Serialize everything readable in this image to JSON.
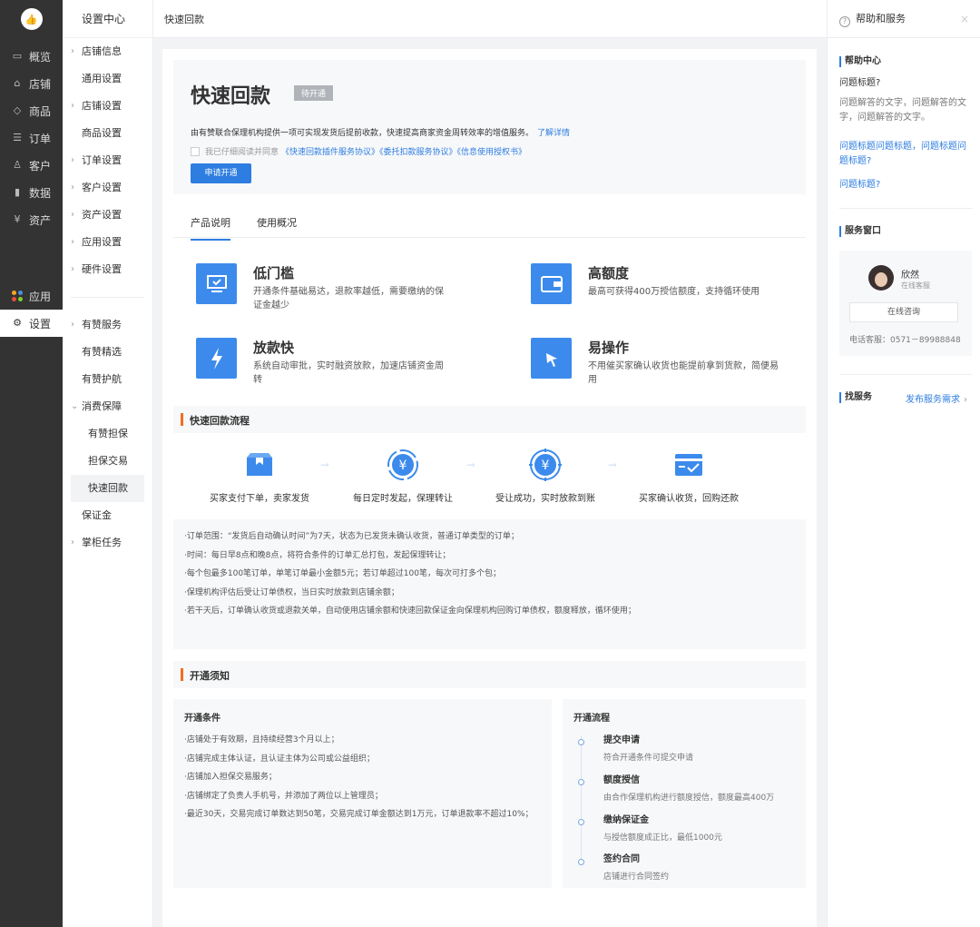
{
  "nav1": {
    "logo_glyph": "👍",
    "items": [
      {
        "label": "概览",
        "icon": "overview-icon",
        "glyph": "▭"
      },
      {
        "label": "店铺",
        "icon": "store-icon",
        "glyph": "⌂"
      },
      {
        "label": "商品",
        "icon": "tag-icon",
        "glyph": "◇"
      },
      {
        "label": "订单",
        "icon": "order-icon",
        "glyph": "☰"
      },
      {
        "label": "客户",
        "icon": "customer-icon",
        "glyph": "♙"
      },
      {
        "label": "数据",
        "icon": "chart-icon",
        "glyph": "▮"
      },
      {
        "label": "资产",
        "icon": "yen-icon",
        "glyph": "¥"
      }
    ],
    "apps_label": "应用",
    "apps_colors": [
      "#f5a623",
      "#4a90e2",
      "#e94b3c",
      "#7ed321"
    ],
    "settings_label": "设置",
    "settings_glyph": "⚙"
  },
  "nav2": {
    "title": "设置中心",
    "group1": [
      {
        "label": "店铺信息",
        "arrow": true
      },
      {
        "label": "通用设置",
        "arrow": false
      },
      {
        "label": "店铺设置",
        "arrow": true
      },
      {
        "label": "商品设置",
        "arrow": false
      },
      {
        "label": "订单设置",
        "arrow": true
      },
      {
        "label": "客户设置",
        "arrow": true
      },
      {
        "label": "资产设置",
        "arrow": true
      },
      {
        "label": "应用设置",
        "arrow": true
      },
      {
        "label": "硬件设置",
        "arrow": true
      }
    ],
    "group2": [
      {
        "label": "有赞服务",
        "arrow": true
      },
      {
        "label": "有赞精选",
        "arrow": false
      },
      {
        "label": "有赞护航",
        "arrow": false
      },
      {
        "label": "消费保障",
        "arrow": true,
        "expanded": true
      },
      {
        "label": "有赞担保",
        "sub": true
      },
      {
        "label": "担保交易",
        "sub": true
      },
      {
        "label": "快速回款",
        "sub": true,
        "active": true
      },
      {
        "label": "保证金",
        "arrow": false
      },
      {
        "label": "掌柜任务",
        "arrow": true
      }
    ]
  },
  "topbar": {
    "breadcrumb": "快速回款"
  },
  "hero": {
    "title": "快速回款",
    "badge": "待开通",
    "desc": "由有赞联合保理机构提供一项可实现发货后提前收款，快速提高商家资金周转效率的增值服务。",
    "desc_link": "了解详情",
    "agree_text": "我已仔细阅读并同意",
    "agree_links": "《快速回款插件服务协议》《委托扣款服务协议》《信息使用授权书》",
    "button": "申请开通"
  },
  "tabs": [
    "产品说明",
    "使用概况"
  ],
  "features": [
    {
      "title": "低门槛",
      "desc": "开通条件基础易达，退款率越低，需要缴纳的保证金越少",
      "icon": "monitor-icon"
    },
    {
      "title": "高额度",
      "desc": "最高可获得400万授信额度，支持循环使用",
      "icon": "wallet-icon"
    },
    {
      "title": "放款快",
      "desc": "系统自动审批，实时融资放款，加速店铺资金周转",
      "icon": "lightning-icon"
    },
    {
      "title": "易操作",
      "desc": "不用催买家确认收货也能提前拿到货款，简便易用",
      "icon": "cursor-click-icon"
    }
  ],
  "flow_section": {
    "title": "快速回款流程",
    "steps": [
      {
        "label": "买家支付下单，卖家发货",
        "icon": "box-icon"
      },
      {
        "label": "每日定时发起，保理转让",
        "icon": "yen-cycle-icon"
      },
      {
        "label": "受让成功，实时放款到账",
        "icon": "yen-target-icon"
      },
      {
        "label": "买家确认收货，回购还款",
        "icon": "card-check-icon"
      }
    ],
    "rules": [
      "·订单范围：“发货后自动确认时间”为7天，状态为已发货未确认收货，普通订单类型的订单；",
      "·时间：每日早8点和晚8点，将符合条件的订单汇总打包，发起保理转让；",
      "·每个包最多100笔订单，单笔订单最小金额5元；若订单超过100笔，每次可打多个包；",
      "·保理机构评估后受让订单债权，当日实时放款到店铺余额；",
      "·若干天后，订单确认收货或退款关单，自动使用店铺余额和快速回款保证金向保理机构回购订单债权，额度释放，循环使用；"
    ]
  },
  "notice_section": {
    "title": "开通须知",
    "conditions_title": "开通条件",
    "conditions": [
      "·店铺处于有效期，且持续经营3个月以上；",
      "·店铺完成主体认证，且认证主体为公司或公益组织；",
      "·店铺加入担保交易服务；",
      "·店铺绑定了负责人手机号，并添加了两位以上管理员；",
      "·最近30天，交易完成订单数达到50笔，交易完成订单金额达到1万元，订单退款率不超过10%；"
    ],
    "process_title": "开通流程",
    "process": [
      {
        "title": "提交申请",
        "desc": "符合开通条件可提交申请"
      },
      {
        "title": "额度授信",
        "desc": "由合作保理机构进行额度授信，额度最高400万"
      },
      {
        "title": "缴纳保证金",
        "desc": "与授信额度成正比，最低1000元"
      },
      {
        "title": "签约合同",
        "desc": "店铺进行合同签约"
      }
    ]
  },
  "rpanel": {
    "title": "帮助和服务",
    "help_title": "帮助中心",
    "q1": "问题标题?",
    "a1": "问题解答的文字，问题解答的文字，问题解答的文字。",
    "q2": "问题标题问题标题，问题标题问题标题?",
    "q3": "问题标题?",
    "service_title": "服务窗口",
    "agent_name": "欣然",
    "agent_role": "在线客服",
    "consult_button": "在线咨询",
    "phone": "电话客服：0571－89988848",
    "find_title": "找服务",
    "find_link": "发布服务需求"
  },
  "colors": {
    "primary": "#2e7de0",
    "accent": "#f26d21",
    "sidebar": "#333333"
  }
}
